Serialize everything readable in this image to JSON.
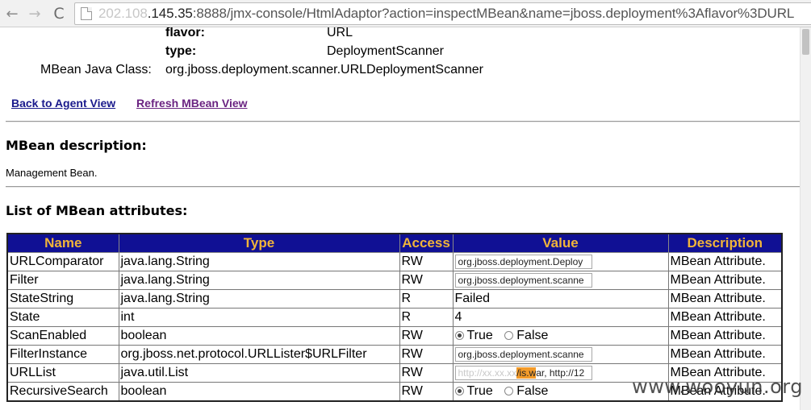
{
  "browser": {
    "back_icon": "arrow-left-icon",
    "forward_icon": "arrow-right-icon",
    "reload_icon": "reload-icon",
    "address_blurred": "202.108",
    "address_host": ".145.35",
    "address_rest": ":8888/jmx-console/HtmlAdaptor?action=inspectMBean&name=jboss.deployment%3Aflavor%3DURL"
  },
  "mbean": {
    "flavor_label": "flavor:",
    "flavor_value": "URL",
    "type_label": "type:",
    "type_value": "DeploymentScanner",
    "class_label": "MBean Java Class:",
    "class_value": "org.jboss.deployment.scanner.URLDeploymentScanner"
  },
  "links": {
    "back": "Back to Agent View",
    "refresh": "Refresh MBean View"
  },
  "description": {
    "heading": "MBean description:",
    "text": "Management Bean."
  },
  "attributes": {
    "heading": "List of MBean attributes:",
    "columns": [
      "Name",
      "Type",
      "Access",
      "Value",
      "Description"
    ],
    "rows": [
      {
        "name": "URLComparator",
        "type": "java.lang.String",
        "access": "RW",
        "value": "org.jboss.deployment.Deploy",
        "desc": "MBean Attribute."
      },
      {
        "name": "Filter",
        "type": "java.lang.String",
        "access": "RW",
        "value": "org.jboss.deployment.scanne",
        "desc": "MBean Attribute."
      },
      {
        "name": "StateString",
        "type": "java.lang.String",
        "access": "R",
        "value": "Failed",
        "desc": "MBean Attribute."
      },
      {
        "name": "State",
        "type": "int",
        "access": "R",
        "value": "4",
        "desc": "MBean Attribute."
      },
      {
        "name": "ScanEnabled",
        "type": "boolean",
        "access": "RW",
        "true_label": "True",
        "false_label": "False",
        "desc": "MBean Attribute."
      },
      {
        "name": "FilterInstance",
        "type": "org.jboss.net.protocol.URLLister$URLFilter",
        "access": "RW",
        "value": "org.jboss.deployment.scanne",
        "desc": "MBean Attribute."
      },
      {
        "name": "URLList",
        "type": "java.util.List",
        "access": "RW",
        "value_blurred": "http://xx.xx.xx",
        "value_highlight_pre": "/is.w",
        "value_highlight_post": "ar, http://12",
        "desc": "MBean Attribute."
      },
      {
        "name": "RecursiveSearch",
        "type": "boolean",
        "access": "RW",
        "true_label": "True",
        "false_label": "False",
        "desc": "MBean Attribute."
      }
    ]
  },
  "watermark": "www.wooyun.org"
}
